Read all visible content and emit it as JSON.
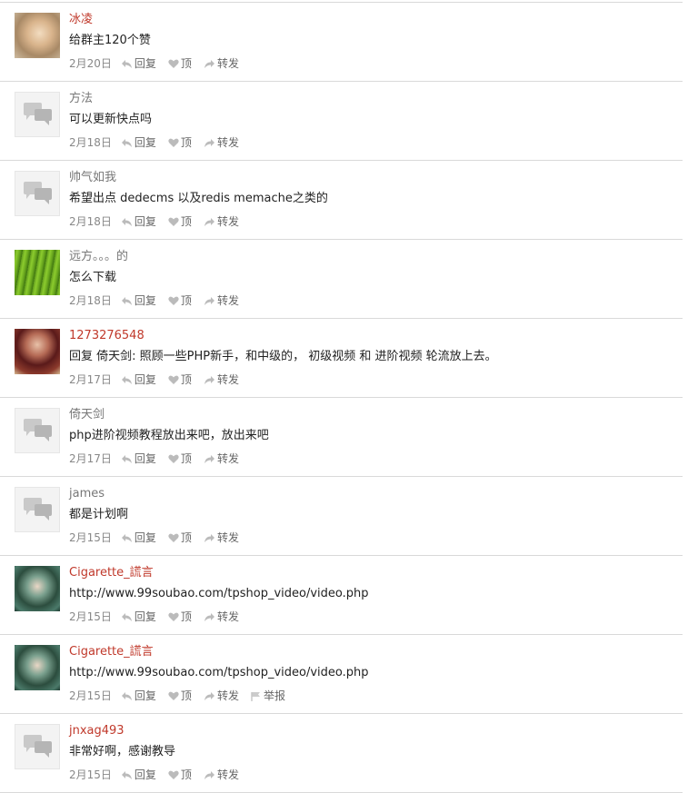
{
  "actions": {
    "reply": "回复",
    "like": "顶",
    "forward": "转发",
    "report": "举报"
  },
  "comments": [
    {
      "name": "冰凌",
      "name_color": "red",
      "avatar": "photo-face",
      "text": "给群主120个赞",
      "date": "2月20日"
    },
    {
      "name": "方法",
      "name_color": "gray",
      "avatar": "default",
      "text": "可以更新快点吗",
      "date": "2月18日"
    },
    {
      "name": "帅气如我",
      "name_color": "gray",
      "avatar": "default",
      "text": "希望出点 dedecms 以及redis memache之类的",
      "date": "2月18日"
    },
    {
      "name": "远方。。。的",
      "name_color": "gray",
      "avatar": "photo-grass",
      "text": "怎么下载",
      "date": "2月18日"
    },
    {
      "name": "1273276548",
      "name_color": "red",
      "avatar": "photo-person",
      "text": "回复 倚天剑: 照顾一些PHP新手，和中级的， 初级视频 和 进阶视频 轮流放上去。",
      "date": "2月17日"
    },
    {
      "name": "倚天剑",
      "name_color": "gray",
      "avatar": "default",
      "text": "php进阶视频教程放出来吧，放出来吧",
      "date": "2月17日"
    },
    {
      "name": "james",
      "name_color": "gray",
      "avatar": "default",
      "text": "都是计划啊",
      "date": "2月15日"
    },
    {
      "name": "Cigarette_謊言",
      "name_color": "red",
      "avatar": "photo-girl",
      "text": "http://www.99soubao.com/tpshop_video/video.php",
      "date": "2月15日"
    },
    {
      "name": "Cigarette_謊言",
      "name_color": "red",
      "avatar": "photo-girl",
      "text": "http://www.99soubao.com/tpshop_video/video.php",
      "date": "2月15日",
      "show_report": true
    },
    {
      "name": "jnxag493",
      "name_color": "red",
      "avatar": "default",
      "text": "非常好啊，感谢教导",
      "date": "2月15日"
    }
  ]
}
